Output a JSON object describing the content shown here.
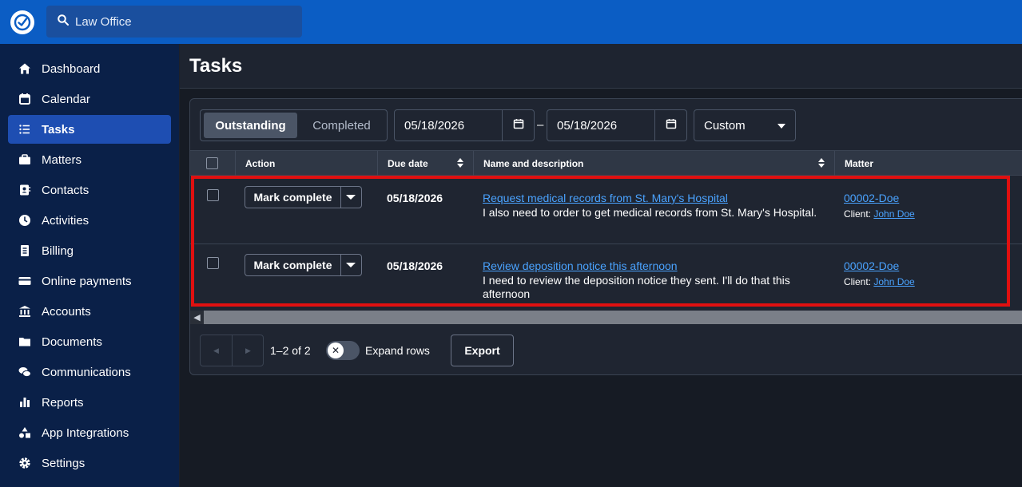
{
  "colors": {
    "topbar": "#0b5dc4",
    "sidebar": "#0a2048",
    "active_nav": "#1e4eb2",
    "link": "#4aa3ff",
    "highlight": "#e01010"
  },
  "topbar": {
    "logo_icon": "check-circle-icon",
    "search_value": "Law Office"
  },
  "sidebar": {
    "items": [
      {
        "label": "Dashboard",
        "icon": "home-icon",
        "active": false
      },
      {
        "label": "Calendar",
        "icon": "calendar-icon",
        "active": false
      },
      {
        "label": "Tasks",
        "icon": "list-icon",
        "active": true
      },
      {
        "label": "Matters",
        "icon": "briefcase-icon",
        "active": false
      },
      {
        "label": "Contacts",
        "icon": "contact-card-icon",
        "active": false
      },
      {
        "label": "Activities",
        "icon": "clock-icon",
        "active": false
      },
      {
        "label": "Billing",
        "icon": "receipt-icon",
        "active": false
      },
      {
        "label": "Online payments",
        "icon": "credit-card-icon",
        "active": false
      },
      {
        "label": "Accounts",
        "icon": "bank-icon",
        "active": false
      },
      {
        "label": "Documents",
        "icon": "folder-icon",
        "active": false
      },
      {
        "label": "Communications",
        "icon": "chat-icon",
        "active": false
      },
      {
        "label": "Reports",
        "icon": "bar-chart-icon",
        "active": false
      },
      {
        "label": "App Integrations",
        "icon": "shapes-icon",
        "active": false
      },
      {
        "label": "Settings",
        "icon": "gear-icon",
        "active": false
      }
    ]
  },
  "page": {
    "title": "Tasks"
  },
  "filters": {
    "tabs": [
      "Outstanding",
      "Completed"
    ],
    "selected_tab": "Outstanding",
    "date_from": "05/18/2026",
    "date_separator": "–",
    "date_to": "05/18/2026",
    "range_select": "Custom"
  },
  "table": {
    "columns": [
      "Action",
      "Due date",
      "Name and description",
      "Matter"
    ],
    "rows": [
      {
        "action": "Mark complete",
        "due_date": "05/18/2026",
        "name": "Request medical records from St. Mary's Hospital",
        "description": "I also need to order to get medical records from St. Mary's Hospital.",
        "matter": "00002-Doe",
        "client_label": "Client:",
        "client": "John Doe"
      },
      {
        "action": "Mark complete",
        "due_date": "05/18/2026",
        "name": "Review deposition notice this afternoon",
        "description": "I need to review the deposition notice they sent. I'll do that this afternoon",
        "matter": "00002-Doe",
        "client_label": "Client:",
        "client": "John Doe"
      }
    ]
  },
  "footer": {
    "page_range": "1–2 of 2",
    "expand_rows_label": "Expand rows",
    "expand_rows_on": false,
    "export_label": "Export"
  }
}
